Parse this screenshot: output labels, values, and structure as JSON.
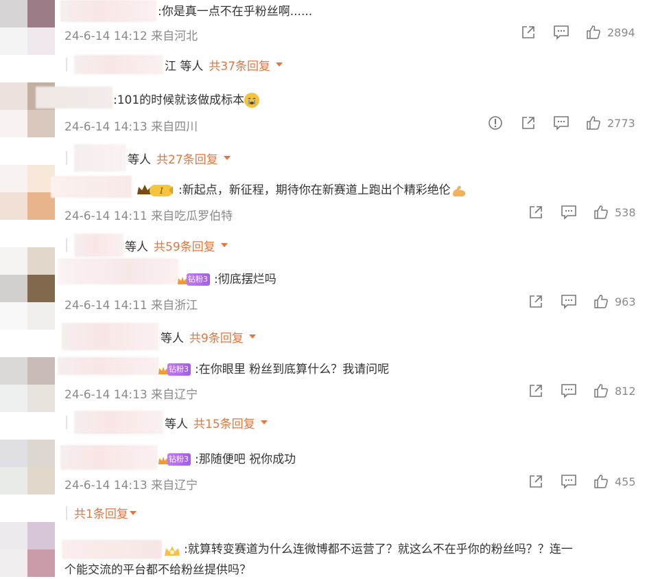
{
  "comments": [
    {
      "text": ":你是真一点不在乎粉丝啊......",
      "time": "24-6-14 14:12",
      "location": "来自河北",
      "likes": "2894",
      "reply_who": "江 等人",
      "reply_count": "共37条回复",
      "avatar": [
        "#d9d4d6",
        "#9b7c87",
        "#f4f4f5",
        "#f1e9ee"
      ]
    },
    {
      "text": ":101的时候就该做成标本",
      "time": "24-6-14 14:13",
      "location": "来自四川",
      "likes": "2773",
      "reply_who": "等人",
      "reply_count": "共27条回复",
      "avatar": [
        "#ece3df",
        "#c2b0a3",
        "#f7f2ef",
        "#d8c7bd"
      ]
    },
    {
      "text": ":新起点，新征程，期待你在新赛道上跑出个精彩绝伦",
      "time": "24-6-14 14:11",
      "location": "来自吃瓜罗伯特",
      "likes": "538",
      "reply_who": "等人",
      "reply_count": "共59条回复",
      "avatar": [
        "#f7f2ef",
        "#f8e9da",
        "#f1e1d6",
        "#e8b48c"
      ]
    },
    {
      "text": ":彻底摆烂吗",
      "time": "24-6-14 14:11",
      "location": "来自浙江",
      "likes": "963",
      "reply_who": "等人",
      "reply_count": "共9条回复",
      "badge": "钻粉3",
      "avatar": [
        "#f6f4f2",
        "#e2d8cc",
        "#d3cfcc",
        "#82684c"
      ]
    },
    {
      "text": ":在你眼里 粉丝到底算什么？我请问呢",
      "time": "24-6-14 14:13",
      "location": "来自辽宁",
      "likes": "812",
      "reply_who": "等人",
      "reply_count": "共15条回复",
      "badge": "钻粉3",
      "avatar": [
        "#dcdad7",
        "#c9bcb8",
        "#eef1ef",
        "#e9e3dd"
      ]
    },
    {
      "text": ":那随便吧 祝你成功",
      "time": "24-6-14 14:13",
      "location": "来自辽宁",
      "likes": "455",
      "reply_count": "共1条回复",
      "badge": "钻粉3",
      "avatar": [
        "#e1e0e4",
        "#ded7d1",
        "#e8ece9",
        "#e0d9cb"
      ]
    },
    {
      "text": ":就算转变赛道为什么连微博都不运营了？就这么不在乎你的粉丝吗？？连一",
      "text2": "个能交流的平台都不给粉丝提供吗？",
      "avatar": [
        "#efeaf0",
        "#d6c6d8",
        "#f2eef0",
        "#c99aa8"
      ]
    }
  ],
  "icons": {
    "share": "share-icon",
    "comment": "comment-icon",
    "like": "thumbs-up-icon",
    "report": "report-icon"
  },
  "colors": {
    "accent": "#e3763c",
    "meta": "#8a8a8a",
    "badge": "#b06ae9"
  }
}
